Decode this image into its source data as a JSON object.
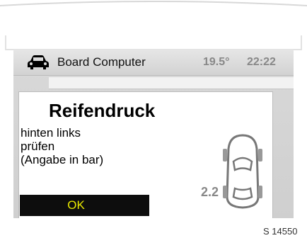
{
  "header": {
    "car_icon": "car-front-icon",
    "title": "Board Computer",
    "temperature": "19.5°",
    "time": "22:22"
  },
  "alert": {
    "title": "Reifendruck",
    "message_lines": [
      "hinten links",
      "prüfen",
      "(Angabe in bar)"
    ],
    "pressure_value": "2.2",
    "car_diagram_icon": "car-top-view-icon",
    "ok_label": "OK"
  },
  "figure_label": "S 14550"
}
